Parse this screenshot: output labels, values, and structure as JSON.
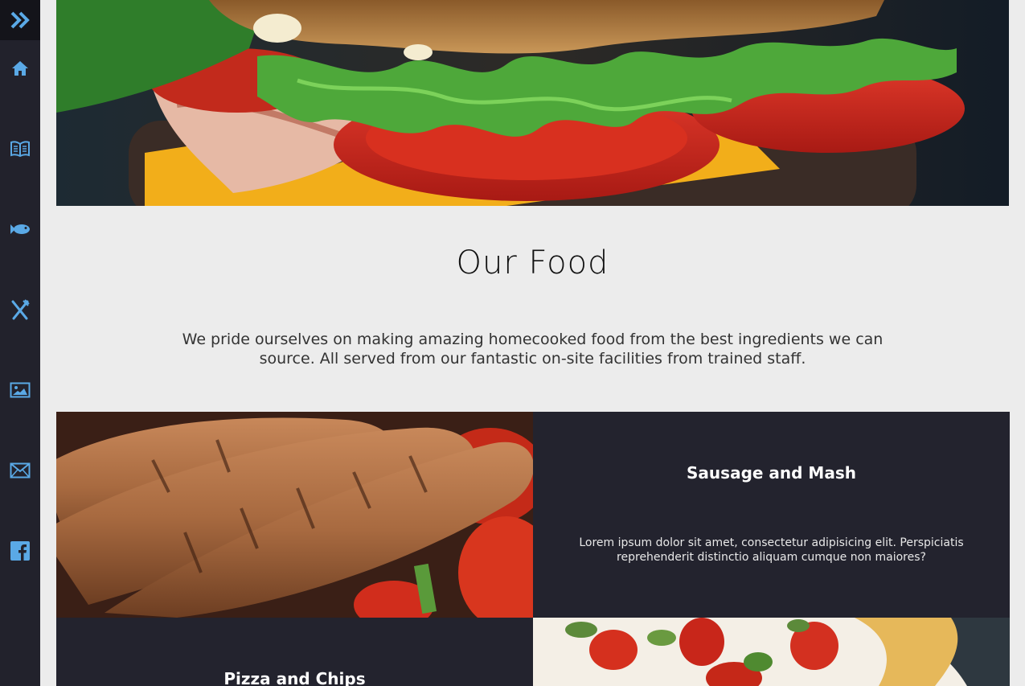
{
  "sidebar": {
    "toggle_icon": "double-chevron-right-icon",
    "items": [
      {
        "icon": "home-icon"
      },
      {
        "icon": "book-icon"
      },
      {
        "icon": "fish-icon"
      },
      {
        "icon": "fork-knife-icon"
      },
      {
        "icon": "image-icon"
      },
      {
        "icon": "mail-icon"
      },
      {
        "icon": "facebook-icon"
      }
    ]
  },
  "colors": {
    "sidebar_bg": "#22222c",
    "accent": "#5aa9e6",
    "page_bg": "#ececec",
    "tile_dark": "#23232e"
  },
  "section": {
    "title": "Our Food",
    "description": "We pride ourselves on making amazing homecooked food from the best ingredients we can source. All served from our fantastic on-site facilities from trained staff."
  },
  "food_items": [
    {
      "title": "Sausage and Mash",
      "text": "Lorem ipsum dolor sit amet, consectetur adipisicing elit. Perspiciatis reprehenderit distinctio aliquam cumque non maiores?"
    },
    {
      "title": "Pizza and Chips"
    }
  ]
}
